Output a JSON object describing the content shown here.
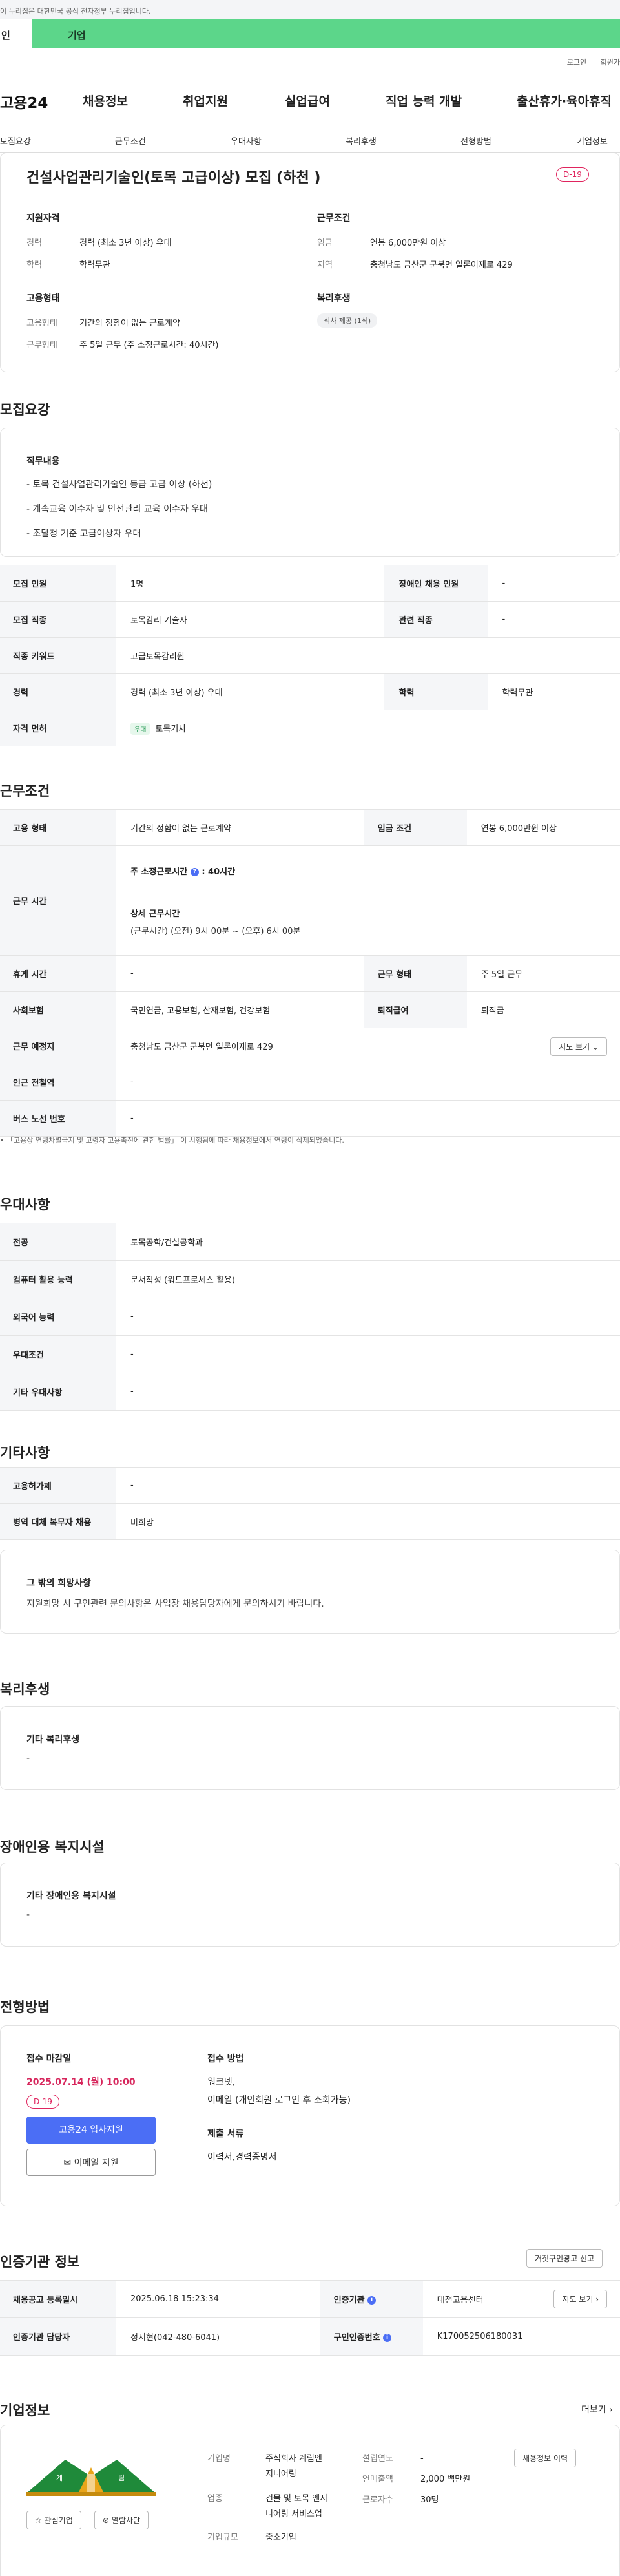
{
  "gov_banner": "이 누리집은 대한민국 공식 전자정부 누리집입니다.",
  "green_bar": {
    "left_tab": "인",
    "tab": "기업"
  },
  "util_links": {
    "login": "로그인",
    "signup": "회원가"
  },
  "gnb": {
    "logo": "고용24",
    "menu": [
      "채용정보",
      "취업지원",
      "실업급여",
      "직업 능력 개발",
      "출산휴가·육아휴직"
    ]
  },
  "tabs": [
    "모집요강",
    "근무조건",
    "우대사항",
    "복리후생",
    "전형방법",
    "기업정보"
  ],
  "hero": {
    "title": "건설사업관리기술인(토목 고급이상) 모집 (하천 )",
    "dday": "D-19",
    "qual": {
      "title": "지원자격",
      "career_label": "경력",
      "career": "경력 (최소 3년 이상) 우대",
      "edu_label": "학력",
      "edu": "학력무관"
    },
    "cond": {
      "title": "근무조건",
      "wage_label": "임금",
      "wage": "연봉 6,000만원 이상",
      "region_label": "지역",
      "region": "충청남도 금산군 군북면 일론이재로 429"
    },
    "emp": {
      "title": "고용형태",
      "type_label": "고용형태",
      "type": "기간의 정함이 없는 근로계약",
      "work_label": "근무형태",
      "work": "주 5일 근무 (주 소정근로시간: 40시간)"
    },
    "welfare": {
      "title": "복리후생",
      "chip": "식사 제공 (1식)"
    }
  },
  "recruit": {
    "title": "모집요강",
    "duty_label": "직무내용",
    "duty_lines": [
      "- 토목 건설사업관리기술인 등급 고급 이상 (하천)",
      "- 계속교육 이수자 및 안전관리 교육 이수자 우대",
      "- 조달청 기준 고급이상자 우대"
    ],
    "rows": {
      "headcount_label": "모집 인원",
      "headcount": "1명",
      "disabled_label": "장애인 채용 인원",
      "disabled": "-",
      "job_label": "모집 직종",
      "job": "토목감리 기술자",
      "related_label": "관련 직종",
      "related": "-",
      "keyword_label": "직종 키워드",
      "keyword": "고급토목감리원",
      "career_label": "경력",
      "career": "경력 (최소 3년 이상) 우대",
      "edu_label": "학력",
      "edu": "학력무관",
      "license_label": "자격 면허",
      "license_tag": "우대",
      "license": "토목기사"
    }
  },
  "workcond": {
    "title": "근무조건",
    "type_label": "고용 형태",
    "type": "기간의 정함이 없는 근로계약",
    "wage_label": "임금 조건",
    "wage": "연봉 6,000만원 이상",
    "hours_label": "근무 시간",
    "hours_weekly": "주 소정근로시간",
    "hours_weekly_value": ": 40시간",
    "hours_detail_title": "상세 근무시간",
    "hours_detail": "(근무시간) (오전) 9시 00분 ~ (오후) 6시 00분",
    "holiday_label": "휴게 시간",
    "holiday": "-",
    "form_label": "근무 형태",
    "form": "주 5일 근무",
    "insurance_label": "사회보험",
    "insurance": "국민연금, 고용보험, 산재보험, 건강보험",
    "severance_label": "퇴직급여",
    "severance": "퇴직금",
    "place_label": "근무 예정지",
    "place": "충청남도 금산군 군북면 일론이재로 429",
    "map_btn": "지도 보기 ⌄",
    "station_label": "인근 전철역",
    "station": "-",
    "bus_label": "버스 노선 번호",
    "bus": "-",
    "note": "• 「고용상 연령차별금지 및 고령자 고용촉진에 관한 법률」 이 시행됨에 따라 채용정보에서 연령이 삭제되었습니다."
  },
  "pref": {
    "title": "우대사항",
    "major_label": "전공",
    "major": "토목공학/건설공학과",
    "computer_label": "컴퓨터 활용 능력",
    "computer": "문서작성 (워드프로세스 활용)",
    "language_label": "외국어 능력",
    "language": "-",
    "cond_label": "우대조건",
    "cond": "-",
    "etc_label": "기타 우대사항",
    "etc": "-"
  },
  "etc": {
    "title": "기타사항",
    "permit_label": "고용허가제",
    "permit": "-",
    "military_label": "병역 대체 복무자 채용",
    "military": "비희망",
    "wish_label": "그 밖의 희망사항",
    "wish": "지원희망 시 구인관련 문의사항은 사업장 채용담당자에게 문의하시기 바랍니다."
  },
  "welfare": {
    "title": "복리후생",
    "label": "기타 복리후생",
    "value": "-"
  },
  "disabled_fac": {
    "title": "장애인용 복지시설",
    "label": "기타 장애인용 복지시설",
    "value": "-"
  },
  "selection": {
    "title": "전형방법",
    "deadline_label": "접수 마감일",
    "deadline": "2025.07.14 (월) 10:00",
    "dday": "D-19",
    "apply_btn": "고용24 입사지원",
    "email_btn": "✉ 이메일 지원",
    "method_label": "접수 방법",
    "method_1": "워크넷,",
    "method_2": "이메일 (개인회원 로그인 후 조회가능)",
    "docs_label": "제출 서류",
    "docs": "이력서,경력증명서"
  },
  "agency": {
    "title": "인증기관 정보",
    "report_btn": "거짓구인광고 신고",
    "reg_label": "채용공고 등록일시",
    "reg": "2025.06.18 15:23:34",
    "org_label": "인증기관",
    "org": "대전고용센터",
    "map_btn": "지도 보기 ›",
    "manager_label": "인증기관 담당자",
    "manager": "정지현(042-480-6041)",
    "no_label": "구인인증번호",
    "no": "K170052506180031"
  },
  "company": {
    "title": "기업정보",
    "more": "더보기 ›",
    "fav_btn": "☆ 관심기업",
    "block_btn": "⊘ 열람차단",
    "name_label": "기업명",
    "name_1": "주식회사 계림엔",
    "name_2": "지니어링",
    "industry_label": "업종",
    "industry_1": "건물 및 토목 엔지",
    "industry_2": "니어링 서비스업",
    "size_label": "기업규모",
    "size": "중소기업",
    "founded_label": "설립연도",
    "founded": "-",
    "revenue_label": "연매출액",
    "revenue": "2,000 백만원",
    "employees_label": "근로자수",
    "employees": "30명",
    "jobs_btn": "채용정보 이력"
  }
}
